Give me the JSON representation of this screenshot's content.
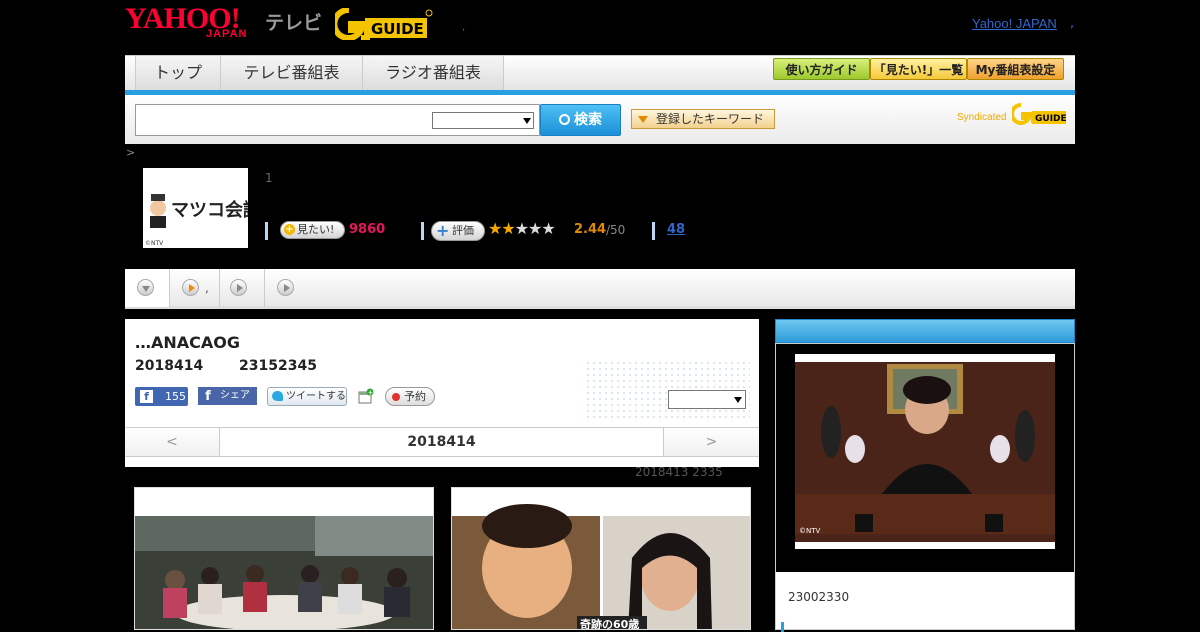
{
  "header": {
    "yahoo_logo": "YAHOO!",
    "yahoo_logo_sub": "JAPAN",
    "tv_label": "テレビ",
    "gguide_logo": "G GUIDE",
    "yahoo_japan_link": "Yahoo! JAPAN",
    "separator": ",",
    "separator2": ","
  },
  "nav": {
    "tabs": [
      {
        "label": "トップ"
      },
      {
        "label": "テレビ番組表"
      },
      {
        "label": "ラジオ番組表"
      }
    ],
    "buttons": [
      {
        "label": "使い方ガイド"
      },
      {
        "label": "「見たい!」一覧"
      },
      {
        "label": "My番組表設定"
      }
    ]
  },
  "search": {
    "input_value": "",
    "select_value": "",
    "button_label": "検索",
    "keyword_button": "登録したキーワード",
    "syndicated_label": "Syndicated",
    "syndicated_logo": "G GUIDE"
  },
  "breadcrumb": ">",
  "program": {
    "thumb_title": "マツコ会議",
    "thumb_credit": "©NTV",
    "episode_num": "1",
    "mitai_label": "見たい!",
    "mitai_count": "9860",
    "hyouka_label": "評価",
    "rating_value": "2.44",
    "rating_max": "/50",
    "rating_stars": 2.44,
    "review_count": "48"
  },
  "tabs": [
    {
      "label": ""
    },
    {
      "label": ","
    },
    {
      "label": ""
    },
    {
      "label": ""
    }
  ],
  "episode": {
    "title": "…ANACAOG",
    "date": "2018414",
    "time": "23152345",
    "fb_like_count": "155",
    "fb_share_label": "シェア",
    "tweet_label": "ツイートする",
    "reserve_label": "予約",
    "select_value": "",
    "prev_label": "<",
    "current_date": "2018414",
    "next_label": ">",
    "prev_broadcast": "2018413  2335"
  },
  "images": {
    "scene1_alt": "restaurant scene",
    "scene2_caption": "奇跡の60歳",
    "right_credit": "©NTV"
  },
  "right_panel": {
    "time": "23002330"
  },
  "colors": {
    "accent_blue": "#2a9fe0",
    "yahoo_red": "#ff0033",
    "gguide_yellow": "#f5c400",
    "mitai_pink": "#e8165c",
    "rating_orange": "#e08a00"
  }
}
